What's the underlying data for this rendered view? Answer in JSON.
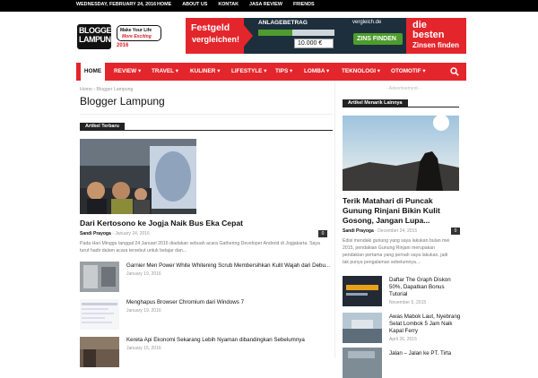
{
  "topbar": {
    "date": "WEDNESDAY, FEBRUARY 24, 2016",
    "links": [
      "HOME",
      "ABOUT US",
      "KONTAK",
      "JASA REVIEW",
      "FRIENDS"
    ]
  },
  "logo": {
    "line1": "BLOGGER",
    "line2": "LAMPUNG",
    "year": "2016",
    "tag1": "Make Your Life",
    "tag2": "More Exciting"
  },
  "banner": {
    "left_line1": "Festgeld",
    "left_line2": "vergleichen!",
    "amount_label": "ANLAGEBETRAG",
    "amount_value": "10.000 €",
    "amount_fill": 0.45,
    "compare_label": "vergleich.de",
    "button": "ZINS FINDEN",
    "right_line1": "die",
    "right_line2": "besten",
    "right_line3": "Zinsen finden",
    "colors": {
      "red": "#e3262c",
      "navy": "#1d2f3c",
      "green": "#4d9c2d"
    }
  },
  "nav": {
    "items": [
      "HOME",
      "REVIEW",
      "TRAVEL",
      "KULINER",
      "LIFESTYLE",
      "TIPS",
      "LOMBA",
      "TEKNOLOGI",
      "OTOMOTIF"
    ],
    "dropdown_items": [
      "REVIEW",
      "TRAVEL",
      "KULINER",
      "LIFESTYLE",
      "TIPS",
      "LOMBA",
      "TEKNOLOGI",
      "OTOMOTIF"
    ],
    "search_icon": "search-icon"
  },
  "breadcrumb": {
    "home": "Home",
    "sep": "›",
    "current": "Blogger Lampung"
  },
  "page_title": "Blogger Lampung",
  "main": {
    "section_label": "Artikel Terbaru",
    "featured": {
      "title": "Dari Kertosono ke Jogja Naik Bus Eka Cepat",
      "author": "Sandi Prayoga",
      "date": "January 24, 2016",
      "comments": "0",
      "excerpt1": "Pada Hari Minggu tanggal 24 Januari 2016 diadakan sebuah acara Gathering Developer Android di Jogjakarta. Saya",
      "excerpt2": "turut hadir dalam acara tersebut untuk belajar dan..."
    },
    "list": [
      {
        "title": "Garnier Men Power White Whitening Scrub Membersihkan Kulit Wajah dari Debu...",
        "date": "January 19, 2016"
      },
      {
        "title": "Menghapus Browser Chromium dari Windows 7",
        "date": "January 19, 2016"
      },
      {
        "title": "Kereta Api Ekonomi Sekarang Lebih Nyaman dibandingkan Sebelumnya",
        "date": "January 15, 2016"
      }
    ]
  },
  "sidebar": {
    "ad_label": "- Advertisement -",
    "section_label": "Artikel Menarik Lainnya",
    "featured": {
      "title": "Terik Matahari di Puncak Gunung Rinjani Bikin Kulit Gosong, Jangan Lupa...",
      "author": "Sandi Prayoga",
      "date": "December 24, 2015",
      "comments": "0",
      "excerpt1": "Edisi mendaki gunung yang saya lakukan bulan mei",
      "excerpt2": "2015, pendakian Gunung Rinjani merupakan",
      "excerpt3": "pendakian pertama yang pernah saya lakukan, jadi",
      "excerpt4": "tak punya pengalaman sebelumnya...."
    },
    "list": [
      {
        "title1": "Daftar The Graph Diskon",
        "title2": "50%, Dapatkan Bonus",
        "title3": "Tutorial",
        "date": "November 5, 2015"
      },
      {
        "title1": "Awas Mabok Laut, Nyebrang",
        "title2": "Selat Lombok 5 Jam Naik",
        "title3": "Kapal Ferry",
        "date": "April 26, 2015"
      },
      {
        "title1": "Jalan – Jalan ke PT. Tirta",
        "title2": "",
        "title3": "",
        "date": ""
      }
    ]
  }
}
